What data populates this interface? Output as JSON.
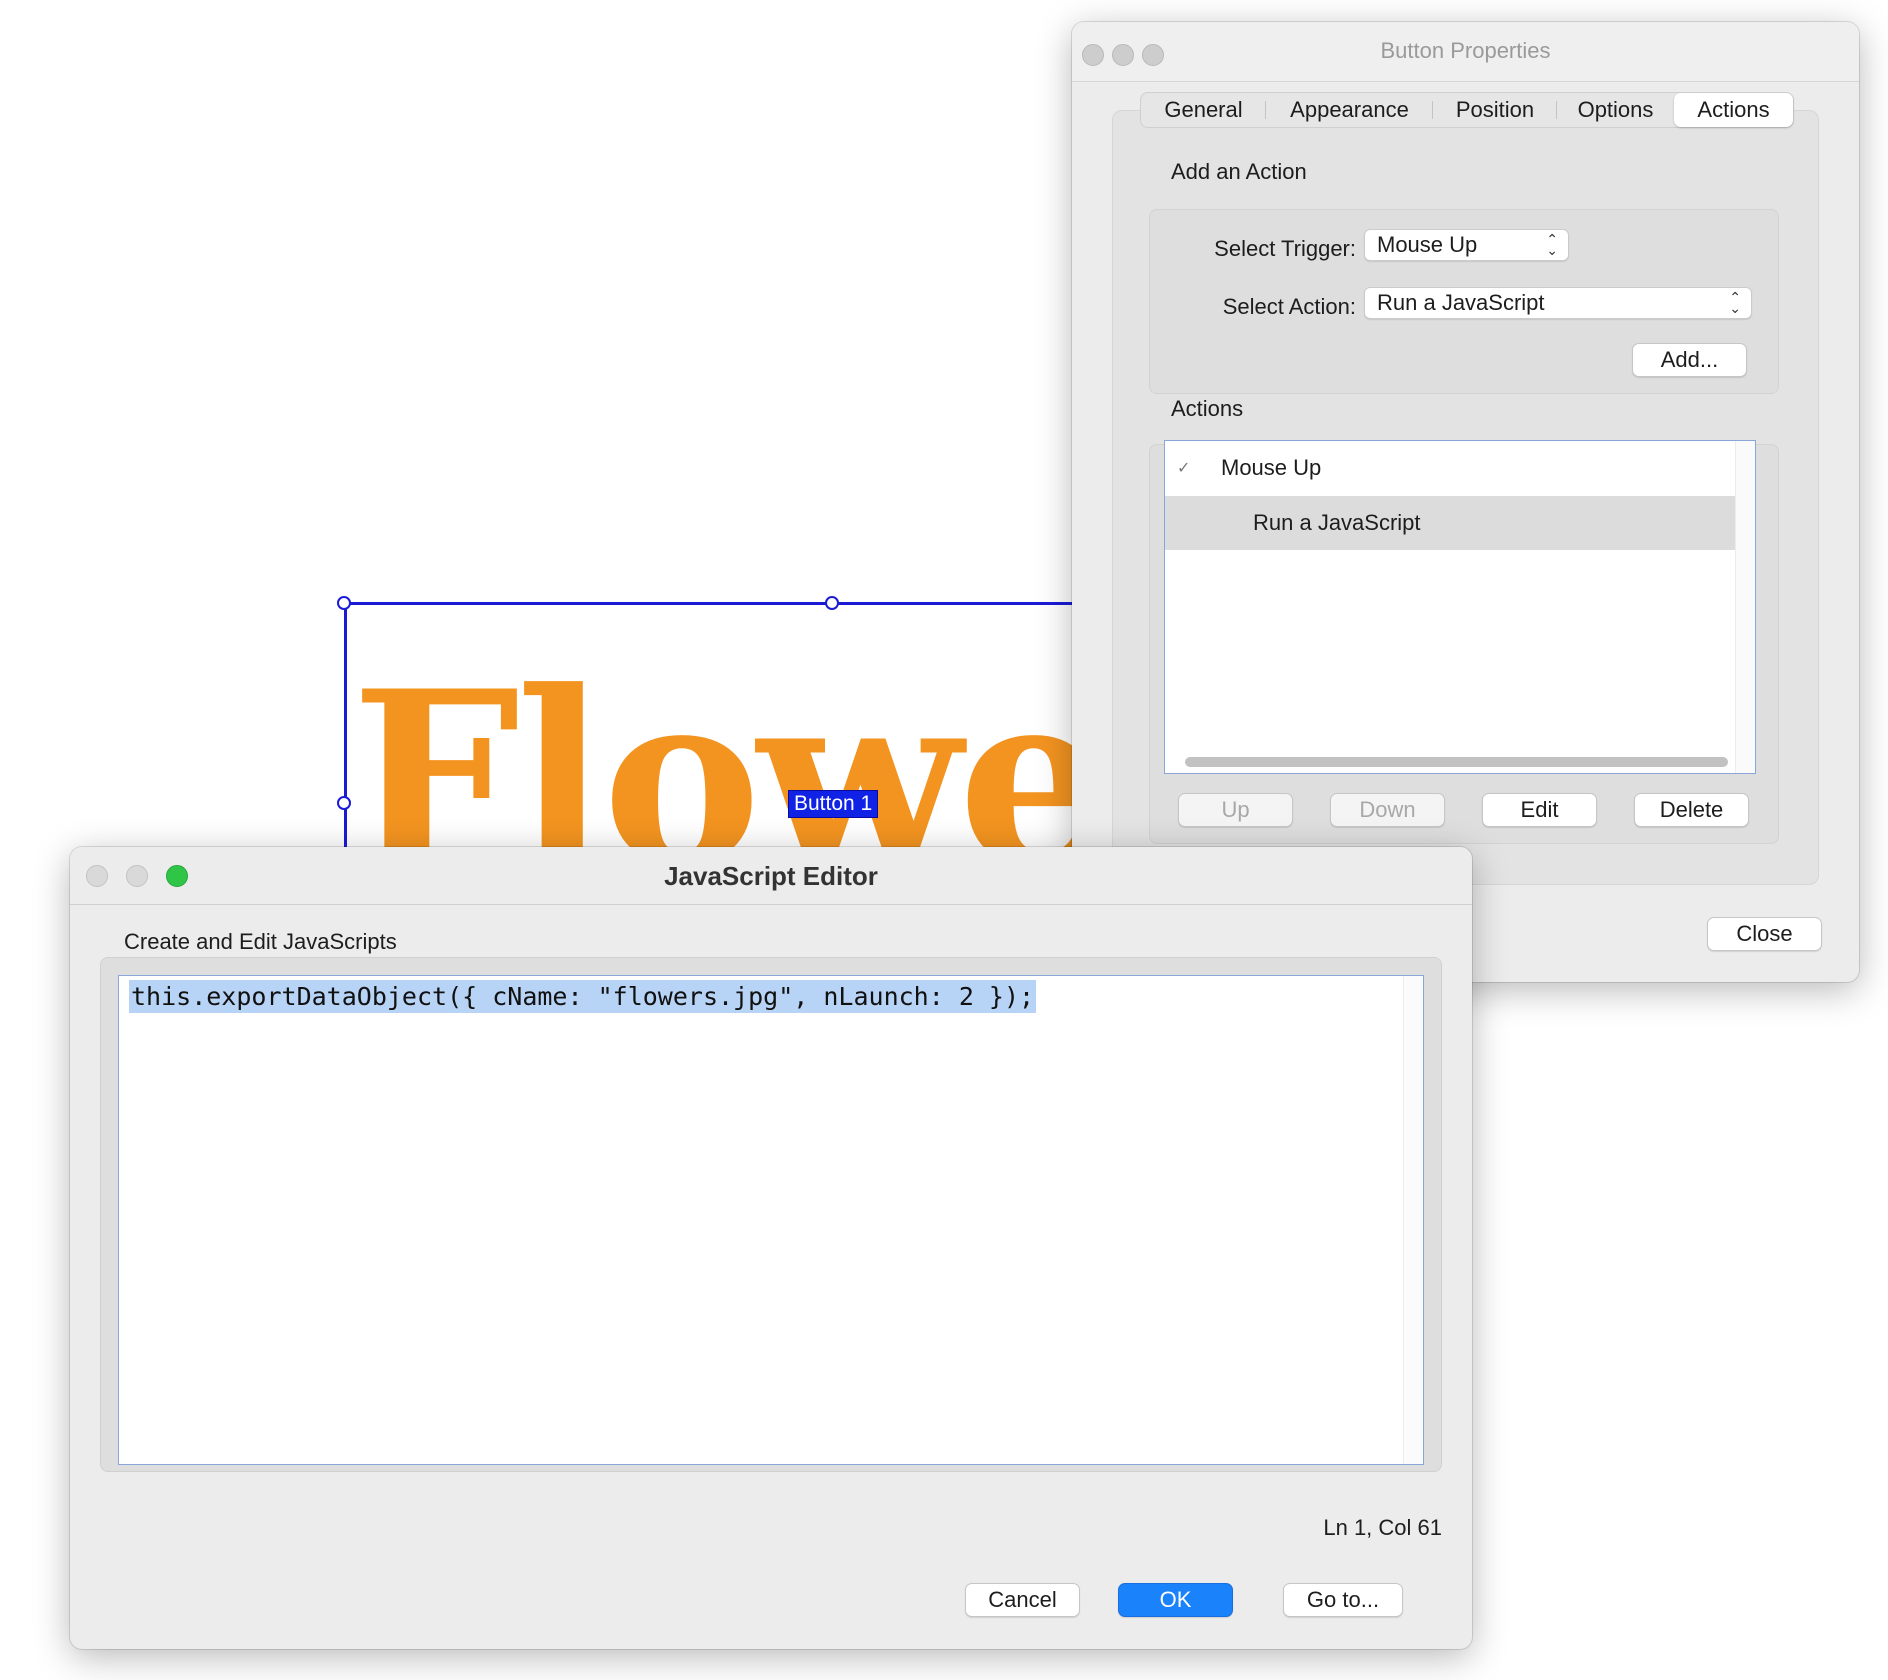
{
  "document": {
    "field_text": "Flowers",
    "field_label": "Button 1",
    "field_text_color": "#f39420",
    "selection_color": "#1b1bd6"
  },
  "properties_window": {
    "title": "Button Properties",
    "tabs": [
      {
        "label": "General",
        "active": false
      },
      {
        "label": "Appearance",
        "active": false
      },
      {
        "label": "Position",
        "active": false
      },
      {
        "label": "Options",
        "active": false
      },
      {
        "label": "Actions",
        "active": true
      }
    ],
    "add_action": {
      "heading": "Add an Action",
      "trigger_label": "Select Trigger:",
      "trigger_value": "Mouse Up",
      "action_label": "Select Action:",
      "action_value": "Run a JavaScript",
      "add_button": "Add..."
    },
    "actions": {
      "heading": "Actions",
      "items": [
        {
          "label": "Mouse Up",
          "level": 0,
          "checked": true
        },
        {
          "label": "Run a JavaScript",
          "level": 1,
          "selected": true
        }
      ],
      "buttons": {
        "up": "Up",
        "down": "Down",
        "edit": "Edit",
        "delete": "Delete"
      }
    },
    "close_button": "Close"
  },
  "editor_window": {
    "title": "JavaScript Editor",
    "subtitle": "Create and Edit JavaScripts",
    "code": "this.exportDataObject({ cName: \"flowers.jpg\", nLaunch: 2 });",
    "status": "Ln 1, Col 61",
    "buttons": {
      "cancel": "Cancel",
      "ok": "OK",
      "goto": "Go to..."
    },
    "accent_color": "#1a82fb"
  }
}
